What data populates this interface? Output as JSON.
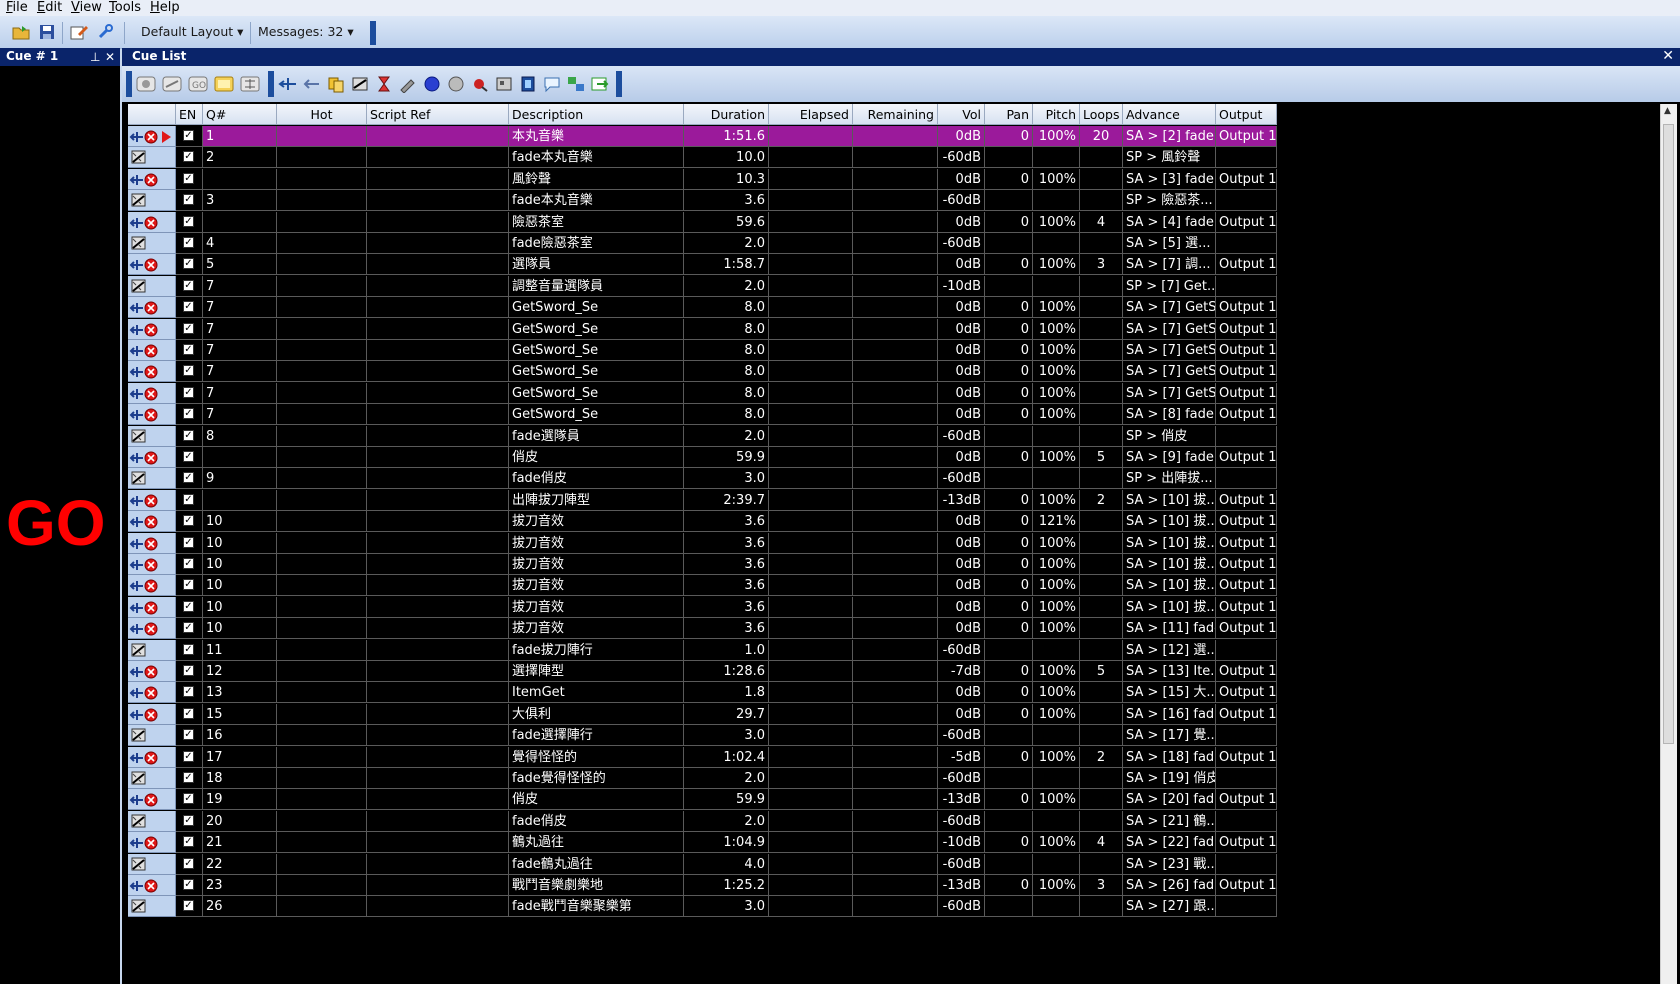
{
  "menu": {
    "items": [
      {
        "key": "F",
        "rest": "ile"
      },
      {
        "key": "E",
        "rest": "dit"
      },
      {
        "key": "V",
        "rest": "iew"
      },
      {
        "key": "T",
        "rest": "ools"
      },
      {
        "key": "H",
        "rest": "elp"
      }
    ]
  },
  "toolbar": {
    "layout_label": "Default Layout",
    "messages_label": "Messages: 32"
  },
  "left_pane": {
    "title": "Cue # 1",
    "go_label": "GO"
  },
  "cue_pane": {
    "title": "Cue List"
  },
  "columns": [
    "",
    "EN",
    "Q#",
    "Hot",
    "Script Ref",
    "Description",
    "Duration",
    "Elapsed",
    "Remaining",
    "Vol",
    "Pan",
    "Pitch",
    "Loops",
    "Advance",
    "Output"
  ],
  "rows": [
    {
      "type": "audio",
      "selected": true,
      "q": "1",
      "desc": "本丸音樂",
      "dur": "1:51.6",
      "vol": "0dB",
      "pan": "0",
      "pitch": "100%",
      "loops": "20",
      "adv": "SA > [2] fade...",
      "out": "Output 1"
    },
    {
      "type": "fade",
      "q": "2",
      "desc": "fade本丸音樂",
      "dur": "10.0",
      "vol": "-60dB",
      "pan": "",
      "pitch": "",
      "loops": "",
      "adv": "SP > 風鈴聲",
      "out": ""
    },
    {
      "type": "audio",
      "q": "",
      "desc": "風鈴聲",
      "dur": "10.3",
      "vol": "0dB",
      "pan": "0",
      "pitch": "100%",
      "loops": "",
      "adv": "SA > [3] fade...",
      "out": "Output 1"
    },
    {
      "type": "fade",
      "q": "3",
      "desc": "fade本丸音樂",
      "dur": "3.6",
      "vol": "-60dB",
      "pan": "",
      "pitch": "",
      "loops": "",
      "adv": "SP > 險惡茶...",
      "out": ""
    },
    {
      "type": "audio",
      "q": "",
      "desc": "險惡茶室",
      "dur": "59.6",
      "vol": "0dB",
      "pan": "0",
      "pitch": "100%",
      "loops": "4",
      "adv": "SA > [4] fade...",
      "out": "Output 1"
    },
    {
      "type": "fade",
      "q": "4",
      "desc": "fade險惡茶室",
      "dur": "2.0",
      "vol": "-60dB",
      "pan": "",
      "pitch": "",
      "loops": "",
      "adv": "SA > [5] 選...",
      "out": ""
    },
    {
      "type": "audio",
      "q": "5",
      "desc": "選隊員",
      "dur": "1:58.7",
      "vol": "0dB",
      "pan": "0",
      "pitch": "100%",
      "loops": "3",
      "adv": "SA > [7] 調...",
      "out": "Output 1"
    },
    {
      "type": "fade",
      "q": "7",
      "desc": "調整音量選隊員",
      "dur": "2.0",
      "vol": "-10dB",
      "pan": "",
      "pitch": "",
      "loops": "",
      "adv": "SP > [7] Get...",
      "out": ""
    },
    {
      "type": "audio",
      "q": "7",
      "desc": "GetSword_Se",
      "dur": "8.0",
      "vol": "0dB",
      "pan": "0",
      "pitch": "100%",
      "loops": "",
      "adv": "SA > [7] GetS...",
      "out": "Output 1"
    },
    {
      "type": "audio",
      "q": "7",
      "desc": "GetSword_Se",
      "dur": "8.0",
      "vol": "0dB",
      "pan": "0",
      "pitch": "100%",
      "loops": "",
      "adv": "SA > [7] GetS...",
      "out": "Output 1"
    },
    {
      "type": "audio",
      "q": "7",
      "desc": "GetSword_Se",
      "dur": "8.0",
      "vol": "0dB",
      "pan": "0",
      "pitch": "100%",
      "loops": "",
      "adv": "SA > [7] GetS...",
      "out": "Output 1"
    },
    {
      "type": "audio",
      "q": "7",
      "desc": "GetSword_Se",
      "dur": "8.0",
      "vol": "0dB",
      "pan": "0",
      "pitch": "100%",
      "loops": "",
      "adv": "SA > [7] GetS...",
      "out": "Output 1"
    },
    {
      "type": "audio",
      "q": "7",
      "desc": "GetSword_Se",
      "dur": "8.0",
      "vol": "0dB",
      "pan": "0",
      "pitch": "100%",
      "loops": "",
      "adv": "SA > [7] GetS...",
      "out": "Output 1"
    },
    {
      "type": "audio",
      "q": "7",
      "desc": "GetSword_Se",
      "dur": "8.0",
      "vol": "0dB",
      "pan": "0",
      "pitch": "100%",
      "loops": "",
      "adv": "SA > [8] fade...",
      "out": "Output 1"
    },
    {
      "type": "fade",
      "q": "8",
      "desc": "fade選隊員",
      "dur": "2.0",
      "vol": "-60dB",
      "pan": "",
      "pitch": "",
      "loops": "",
      "adv": "SP > 俏皮",
      "out": ""
    },
    {
      "type": "audio",
      "q": "",
      "desc": "俏皮",
      "dur": "59.9",
      "vol": "0dB",
      "pan": "0",
      "pitch": "100%",
      "loops": "5",
      "adv": "SA > [9] fade...",
      "out": "Output 1"
    },
    {
      "type": "fade",
      "q": "9",
      "desc": "fade俏皮",
      "dur": "3.0",
      "vol": "-60dB",
      "pan": "",
      "pitch": "",
      "loops": "",
      "adv": "SP > 出陣拔...",
      "out": ""
    },
    {
      "type": "audio",
      "q": "",
      "desc": "出陣拔刀陣型",
      "dur": "2:39.7",
      "vol": "-13dB",
      "pan": "0",
      "pitch": "100%",
      "loops": "2",
      "adv": "SA > [10] 拔...",
      "out": "Output 1"
    },
    {
      "type": "audio",
      "q": "10",
      "desc": "拔刀音效",
      "dur": "3.6",
      "vol": "0dB",
      "pan": "0",
      "pitch": "121%",
      "loops": "",
      "adv": "SA > [10] 拔...",
      "out": "Output 1"
    },
    {
      "type": "audio",
      "q": "10",
      "desc": "拔刀音效",
      "dur": "3.6",
      "vol": "0dB",
      "pan": "0",
      "pitch": "100%",
      "loops": "",
      "adv": "SA > [10] 拔...",
      "out": "Output 1"
    },
    {
      "type": "audio",
      "q": "10",
      "desc": "拔刀音效",
      "dur": "3.6",
      "vol": "0dB",
      "pan": "0",
      "pitch": "100%",
      "loops": "",
      "adv": "SA > [10] 拔...",
      "out": "Output 1"
    },
    {
      "type": "audio",
      "q": "10",
      "desc": "拔刀音效",
      "dur": "3.6",
      "vol": "0dB",
      "pan": "0",
      "pitch": "100%",
      "loops": "",
      "adv": "SA > [10] 拔...",
      "out": "Output 1"
    },
    {
      "type": "audio",
      "q": "10",
      "desc": "拔刀音效",
      "dur": "3.6",
      "vol": "0dB",
      "pan": "0",
      "pitch": "100%",
      "loops": "",
      "adv": "SA > [10] 拔...",
      "out": "Output 1"
    },
    {
      "type": "audio",
      "q": "10",
      "desc": "拔刀音效",
      "dur": "3.6",
      "vol": "0dB",
      "pan": "0",
      "pitch": "100%",
      "loops": "",
      "adv": "SA > [11] fade...",
      "out": "Output 1"
    },
    {
      "type": "fade",
      "q": "11",
      "desc": "fade拔刀陣行",
      "dur": "1.0",
      "vol": "-60dB",
      "pan": "",
      "pitch": "",
      "loops": "",
      "adv": "SA > [12] 選...",
      "out": ""
    },
    {
      "type": "audio",
      "q": "12",
      "desc": "選擇陣型",
      "dur": "1:28.6",
      "vol": "-7dB",
      "pan": "0",
      "pitch": "100%",
      "loops": "5",
      "adv": "SA > [13] Ite...",
      "out": "Output 1"
    },
    {
      "type": "audio",
      "q": "13",
      "desc": "ItemGet",
      "dur": "1.8",
      "vol": "0dB",
      "pan": "0",
      "pitch": "100%",
      "loops": "",
      "adv": "SA > [15] 大...",
      "out": "Output 1"
    },
    {
      "type": "audio",
      "q": "15",
      "desc": "大俱利",
      "dur": "29.7",
      "vol": "0dB",
      "pan": "0",
      "pitch": "100%",
      "loops": "",
      "adv": "SA > [16] fad...",
      "out": "Output 1"
    },
    {
      "type": "fade",
      "q": "16",
      "desc": "fade選擇陣行",
      "dur": "3.0",
      "vol": "-60dB",
      "pan": "",
      "pitch": "",
      "loops": "",
      "adv": "SA > [17] 覺...",
      "out": ""
    },
    {
      "type": "audio",
      "q": "17",
      "desc": "覺得怪怪的",
      "dur": "1:02.4",
      "vol": "-5dB",
      "pan": "0",
      "pitch": "100%",
      "loops": "2",
      "adv": "SA > [18] fad...",
      "out": "Output 1"
    },
    {
      "type": "fade",
      "q": "18",
      "desc": "fade覺得怪怪的",
      "dur": "2.0",
      "vol": "-60dB",
      "pan": "",
      "pitch": "",
      "loops": "",
      "adv": "SA > [19] 俏皮",
      "out": ""
    },
    {
      "type": "audio",
      "q": "19",
      "desc": "俏皮",
      "dur": "59.9",
      "vol": "-13dB",
      "pan": "0",
      "pitch": "100%",
      "loops": "",
      "adv": "SA > [20] fad...",
      "out": "Output 1"
    },
    {
      "type": "fade",
      "q": "20",
      "desc": "fade俏皮",
      "dur": "2.0",
      "vol": "-60dB",
      "pan": "",
      "pitch": "",
      "loops": "",
      "adv": "SA > [21] 鶴...",
      "out": ""
    },
    {
      "type": "audio",
      "q": "21",
      "desc": "鶴丸過往",
      "dur": "1:04.9",
      "vol": "-10dB",
      "pan": "0",
      "pitch": "100%",
      "loops": "4",
      "adv": "SA > [22] fad...",
      "out": "Output 1"
    },
    {
      "type": "fade",
      "q": "22",
      "desc": "fade鶴丸過往",
      "dur": "4.0",
      "vol": "-60dB",
      "pan": "",
      "pitch": "",
      "loops": "",
      "adv": "SA > [23] 戰...",
      "out": ""
    },
    {
      "type": "audio",
      "q": "23",
      "desc": "戰鬥音樂劇樂地",
      "dur": "1:25.2",
      "vol": "-13dB",
      "pan": "0",
      "pitch": "100%",
      "loops": "3",
      "adv": "SA > [26] fad...",
      "out": "Output 1"
    },
    {
      "type": "fade",
      "q": "26",
      "desc": "fade戰鬥音樂聚樂第",
      "dur": "3.0",
      "vol": "-60dB",
      "pan": "",
      "pitch": "",
      "loops": "",
      "adv": "SA > [27] 跟...",
      "out": ""
    }
  ]
}
